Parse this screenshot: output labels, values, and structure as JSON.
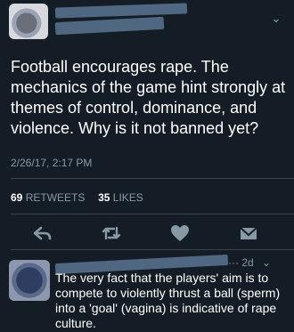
{
  "tweet": {
    "text": "Football encourages rape. The mechanics of the game hint strongly at themes of control, dominance, and violence. Why is it not banned yet?",
    "timestamp": "2/26/17, 2:17 PM",
    "retweets_count": "69",
    "retweets_label": "RETWEETS",
    "likes_count": "35",
    "likes_label": "LIKES"
  },
  "actions": {
    "reply_icon": "reply-arrow-icon",
    "retweet_icon": "retweet-icon",
    "like_icon": "heart-icon",
    "message_icon": "envelope-icon"
  },
  "reply": {
    "time": "2d",
    "text": "The very fact that the players' aim is to compete to violently thrust a ball (sperm) into a 'goal' (vagina) is indicative of rape culture."
  },
  "colors": {
    "background": "#141d26",
    "text": "#ffffff",
    "muted": "#8899a6",
    "divider": "#38444d",
    "redaction": "#4f6781"
  }
}
